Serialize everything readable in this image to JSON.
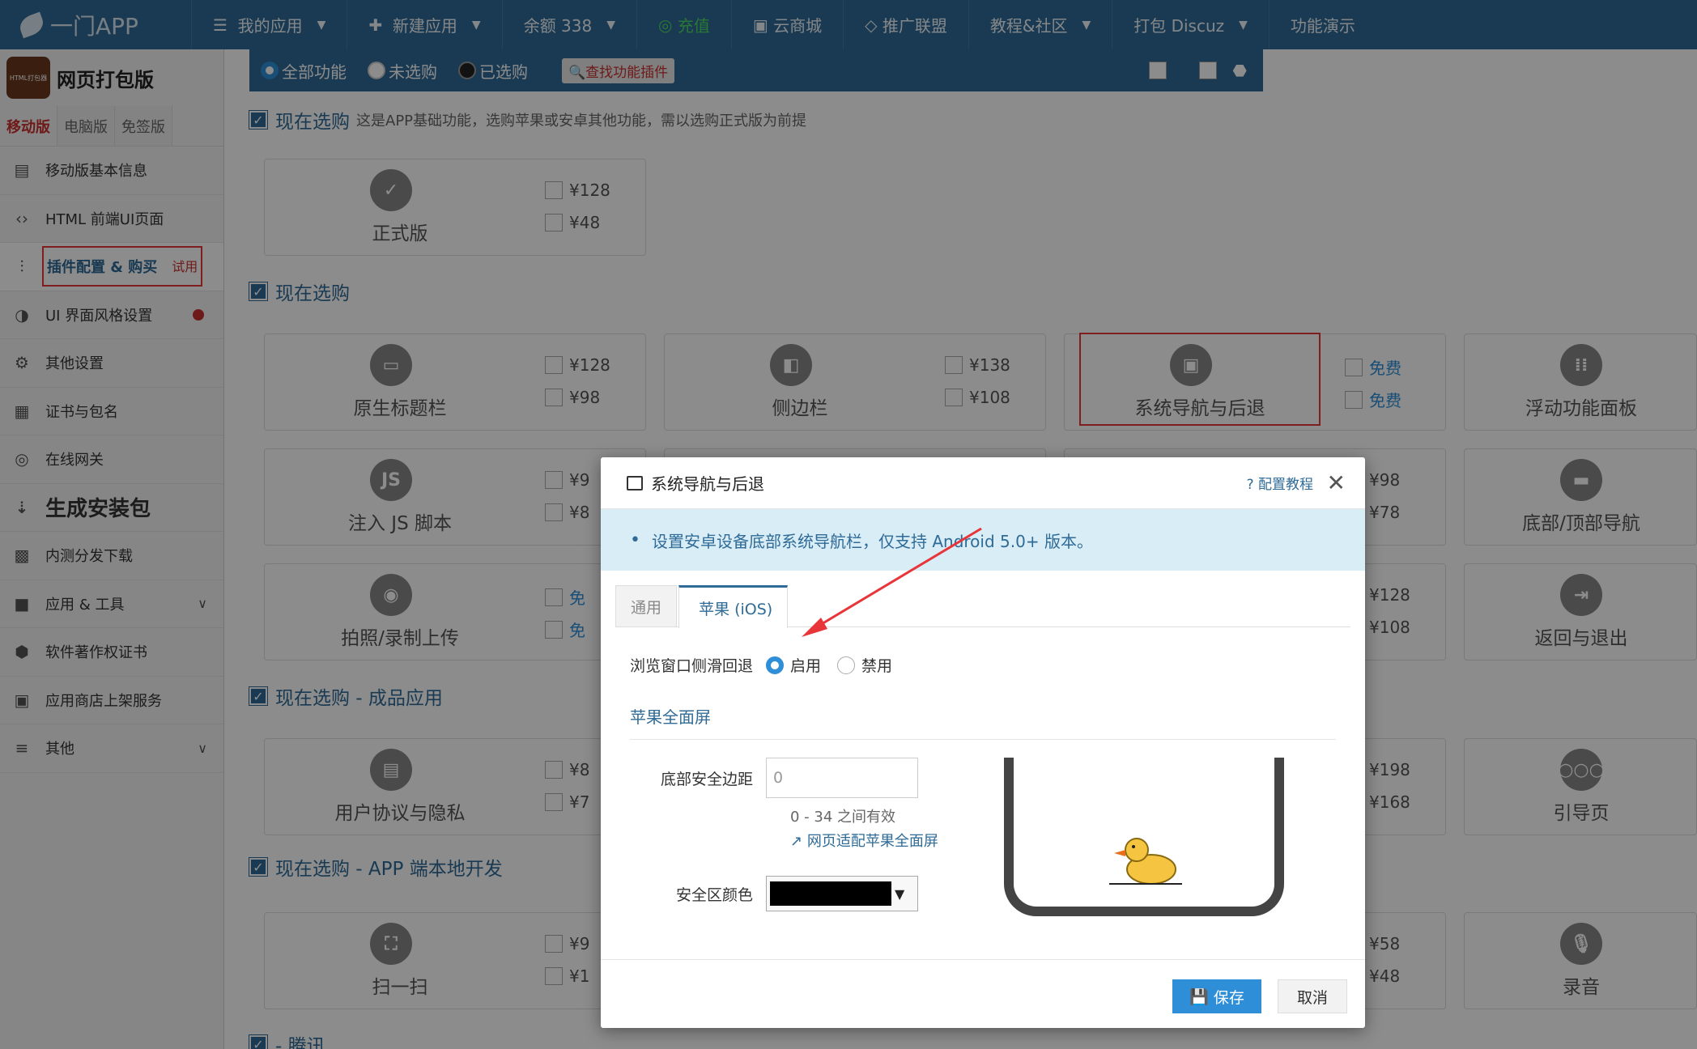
{
  "topbar": {
    "logo": "一门APP",
    "nav": [
      {
        "label": "我的应用",
        "icon": "menu-icon",
        "caret": true
      },
      {
        "label": "新建应用",
        "icon": "plus-icon",
        "caret": true
      },
      {
        "label": "余额 338",
        "icon": "",
        "caret": true
      },
      {
        "label": "充值",
        "icon": "wechat-icon",
        "caret": false,
        "green": true
      },
      {
        "label": "云商城",
        "icon": "shop-icon",
        "caret": false
      },
      {
        "label": "推广联盟",
        "icon": "diamond-icon",
        "caret": false
      },
      {
        "label": "教程&社区",
        "icon": "",
        "caret": true
      },
      {
        "label": "打包 Discuz",
        "icon": "",
        "caret": true
      },
      {
        "label": "功能演示",
        "icon": "",
        "caret": false
      }
    ]
  },
  "sidebar": {
    "app_icon_text": "HTML打包器",
    "app_name": "网页打包版",
    "tabs": [
      "移动版",
      "电脑版",
      "免签版"
    ],
    "items": [
      {
        "label": "移动版基本信息",
        "icon": "document-icon"
      },
      {
        "label": "HTML 前端UI页面",
        "icon": "code-icon"
      },
      {
        "label": "插件配置 & 购买",
        "icon": "sliders-icon",
        "badge": "试用",
        "current": true
      },
      {
        "label": "UI 界面风格设置",
        "icon": "palette-icon",
        "dot": true
      },
      {
        "label": "其他设置",
        "icon": "gear-icon"
      },
      {
        "label": "证书与包名",
        "icon": "certificate-icon"
      },
      {
        "label": "在线网关",
        "icon": "gateway-icon"
      },
      {
        "label": "生成安装包",
        "icon": "sort-icon",
        "big": true
      },
      {
        "label": "内测分发下载",
        "icon": "qrcode-icon"
      },
      {
        "label": "应用 & 工具",
        "icon": "apps-icon",
        "chevron": true
      },
      {
        "label": "软件著作权证书",
        "icon": "copyright-icon"
      },
      {
        "label": "应用商店上架服务",
        "icon": "store-icon"
      },
      {
        "label": "其他",
        "icon": "bars-icon",
        "chevron": true
      }
    ]
  },
  "filter": {
    "options": [
      "全部功能",
      "未选购",
      "已选购"
    ],
    "find_button": "查找功能插件"
  },
  "sections": [
    {
      "title": "现在选购",
      "note": "这是APP基础功能，选购苹果或安卓其他功能，需以选购正式版为前提"
    },
    {
      "title": "现在选购",
      "note": ""
    },
    {
      "title": "现在选购 - 成品应用",
      "note": ""
    },
    {
      "title": "现在选购 - APP 端本地开发",
      "note": ""
    },
    {
      "title": "- 腾讯",
      "note": ""
    }
  ],
  "cards": [
    {
      "name": "正式版",
      "icon": "badge-check-icon",
      "ios": "¥128",
      "android": "¥48"
    },
    {
      "name": "原生标题栏",
      "icon": "titlebar-icon",
      "ios": "¥128",
      "android": "¥98"
    },
    {
      "name": "侧边栏",
      "icon": "sidebar-panel-icon",
      "ios": "¥138",
      "android": "¥108"
    },
    {
      "name": "系统导航与后退",
      "icon": "window-icon",
      "ios": "免费",
      "android": "免费"
    },
    {
      "name": "浮动功能面板",
      "icon": "grid-dots-icon",
      "ios": "",
      "android": ""
    },
    {
      "name": "注入 JS 脚本",
      "icon": "js-icon",
      "ios": "¥9",
      "android": "¥8"
    },
    {
      "name": "",
      "icon": "",
      "ios": "¥98",
      "android": "¥78"
    },
    {
      "name": "底部/顶部导航",
      "icon": "tabbar-icon",
      "ios": "",
      "android": ""
    },
    {
      "name": "拍照/录制上传",
      "icon": "camera-icon",
      "ios": "免",
      "android": "免"
    },
    {
      "name": "",
      "icon": "",
      "ios": "¥128",
      "android": "¥108"
    },
    {
      "name": "返回与退出",
      "icon": "exit-icon",
      "ios": "",
      "android": ""
    },
    {
      "name": "用户协议与隐私",
      "icon": "contract-icon",
      "ios": "¥8",
      "android": "¥7"
    },
    {
      "name": "",
      "icon": "",
      "ios": "¥198",
      "android": "¥168"
    },
    {
      "name": "引导页",
      "icon": "dots-icon",
      "ios": "",
      "android": ""
    },
    {
      "name": "扫一扫",
      "icon": "scan-icon",
      "ios": "¥9",
      "android": "¥1"
    },
    {
      "name": "",
      "icon": "",
      "ios": "¥58",
      "android": "¥48"
    },
    {
      "name": "录音",
      "icon": "mic-icon",
      "ios": "",
      "android": ""
    }
  ],
  "modal": {
    "title": "系统导航与后退",
    "help": "配置教程",
    "alert": "设置安卓设备底部系统导航栏，仅支持 Android 5.0+ 版本。",
    "tabs": [
      "通用",
      "苹果 (iOS)"
    ],
    "swipe_back": {
      "label": "浏览窗口侧滑回退",
      "options": [
        "启用",
        "禁用"
      ],
      "selected": "启用"
    },
    "fullscreen_title": "苹果全面屏",
    "bottom_margin": {
      "label": "底部安全边距",
      "value": "0",
      "hint": "0 - 34 之间有效",
      "link": "网页适配苹果全面屏"
    },
    "safe_color": {
      "label": "安全区颜色",
      "value": "#000000"
    },
    "save": "保存",
    "cancel": "取消"
  }
}
